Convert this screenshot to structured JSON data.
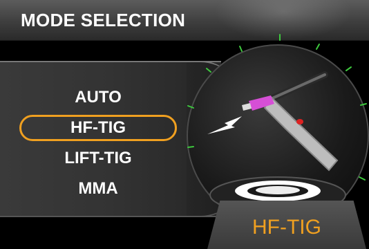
{
  "header": {
    "title": "MODE SELECTION"
  },
  "modes": [
    {
      "label": "AUTO",
      "selected": false
    },
    {
      "label": "HF-TIG",
      "selected": true
    },
    {
      "label": "LIFT-TIG",
      "selected": false
    },
    {
      "label": "MMA",
      "selected": false
    }
  ],
  "current_mode": {
    "label": "HF-TIG"
  },
  "colors": {
    "accent": "#f0a020",
    "tick": "#3ec93e",
    "torch_tip": "#d64fd6"
  },
  "icons": [
    "tig-torch-icon",
    "arc-spark-icon",
    "pedestal-icon"
  ]
}
